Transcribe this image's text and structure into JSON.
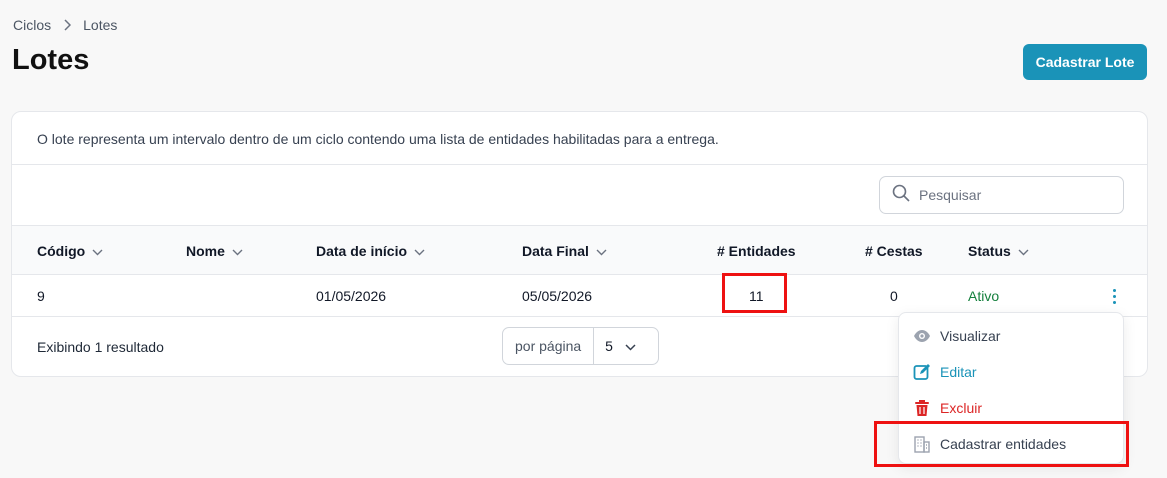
{
  "breadcrumb": {
    "items": [
      "Ciclos",
      "Lotes"
    ]
  },
  "page": {
    "title": "Lotes",
    "action_label": "Cadastrar Lote"
  },
  "card": {
    "description": "O lote representa um intervalo dentro de um ciclo contendo uma lista de entidades habilitadas para a entrega."
  },
  "search": {
    "placeholder": "Pesquisar",
    "value": ""
  },
  "table": {
    "columns": [
      "Código",
      "Nome",
      "Data de início",
      "Data Final",
      "# Entidades",
      "# Cestas",
      "Status"
    ],
    "rows": [
      {
        "codigo": "9",
        "nome": "",
        "data_inicio": "01/05/2026",
        "data_final": "05/05/2026",
        "entidades": "11",
        "cestas": "0",
        "status": "Ativo"
      }
    ]
  },
  "footer": {
    "result_text": "Exibindo 1 resultado",
    "per_page_label": "por página",
    "per_page_value": "5"
  },
  "row_menu": {
    "items": [
      {
        "label": "Visualizar",
        "icon": "eye-icon",
        "color": "#374151"
      },
      {
        "label": "Editar",
        "icon": "edit-icon",
        "color": "#1a93b8"
      },
      {
        "label": "Excluir",
        "icon": "trash-icon",
        "color": "#dc2626"
      },
      {
        "label": "Cadastrar entidades",
        "icon": "building-icon",
        "color": "#374151"
      }
    ]
  },
  "colors": {
    "primary": "#1a93b8",
    "danger": "#dc2626",
    "success": "#15803d",
    "highlight": "#ee1111"
  }
}
